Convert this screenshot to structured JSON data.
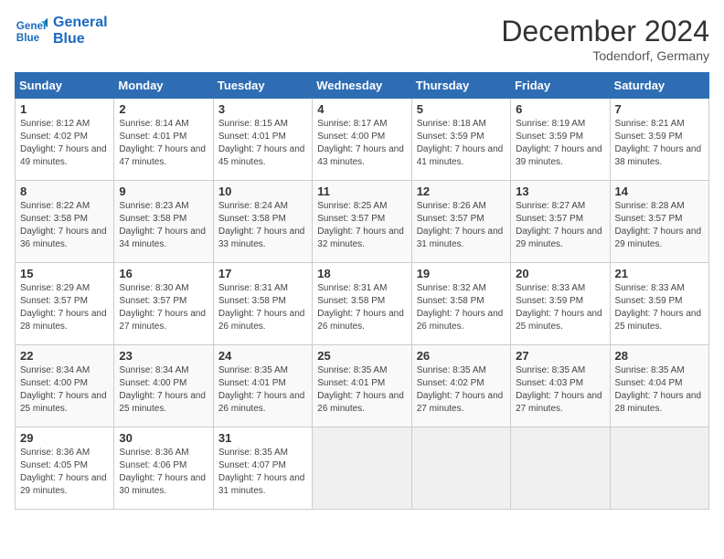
{
  "header": {
    "logo_line1": "General",
    "logo_line2": "Blue",
    "month": "December 2024",
    "location": "Todendorf, Germany"
  },
  "days_of_week": [
    "Sunday",
    "Monday",
    "Tuesday",
    "Wednesday",
    "Thursday",
    "Friday",
    "Saturday"
  ],
  "weeks": [
    [
      {
        "num": "1",
        "sunrise": "Sunrise: 8:12 AM",
        "sunset": "Sunset: 4:02 PM",
        "daylight": "Daylight: 7 hours and 49 minutes."
      },
      {
        "num": "2",
        "sunrise": "Sunrise: 8:14 AM",
        "sunset": "Sunset: 4:01 PM",
        "daylight": "Daylight: 7 hours and 47 minutes."
      },
      {
        "num": "3",
        "sunrise": "Sunrise: 8:15 AM",
        "sunset": "Sunset: 4:01 PM",
        "daylight": "Daylight: 7 hours and 45 minutes."
      },
      {
        "num": "4",
        "sunrise": "Sunrise: 8:17 AM",
        "sunset": "Sunset: 4:00 PM",
        "daylight": "Daylight: 7 hours and 43 minutes."
      },
      {
        "num": "5",
        "sunrise": "Sunrise: 8:18 AM",
        "sunset": "Sunset: 3:59 PM",
        "daylight": "Daylight: 7 hours and 41 minutes."
      },
      {
        "num": "6",
        "sunrise": "Sunrise: 8:19 AM",
        "sunset": "Sunset: 3:59 PM",
        "daylight": "Daylight: 7 hours and 39 minutes."
      },
      {
        "num": "7",
        "sunrise": "Sunrise: 8:21 AM",
        "sunset": "Sunset: 3:59 PM",
        "daylight": "Daylight: 7 hours and 38 minutes."
      }
    ],
    [
      {
        "num": "8",
        "sunrise": "Sunrise: 8:22 AM",
        "sunset": "Sunset: 3:58 PM",
        "daylight": "Daylight: 7 hours and 36 minutes."
      },
      {
        "num": "9",
        "sunrise": "Sunrise: 8:23 AM",
        "sunset": "Sunset: 3:58 PM",
        "daylight": "Daylight: 7 hours and 34 minutes."
      },
      {
        "num": "10",
        "sunrise": "Sunrise: 8:24 AM",
        "sunset": "Sunset: 3:58 PM",
        "daylight": "Daylight: 7 hours and 33 minutes."
      },
      {
        "num": "11",
        "sunrise": "Sunrise: 8:25 AM",
        "sunset": "Sunset: 3:57 PM",
        "daylight": "Daylight: 7 hours and 32 minutes."
      },
      {
        "num": "12",
        "sunrise": "Sunrise: 8:26 AM",
        "sunset": "Sunset: 3:57 PM",
        "daylight": "Daylight: 7 hours and 31 minutes."
      },
      {
        "num": "13",
        "sunrise": "Sunrise: 8:27 AM",
        "sunset": "Sunset: 3:57 PM",
        "daylight": "Daylight: 7 hours and 29 minutes."
      },
      {
        "num": "14",
        "sunrise": "Sunrise: 8:28 AM",
        "sunset": "Sunset: 3:57 PM",
        "daylight": "Daylight: 7 hours and 29 minutes."
      }
    ],
    [
      {
        "num": "15",
        "sunrise": "Sunrise: 8:29 AM",
        "sunset": "Sunset: 3:57 PM",
        "daylight": "Daylight: 7 hours and 28 minutes."
      },
      {
        "num": "16",
        "sunrise": "Sunrise: 8:30 AM",
        "sunset": "Sunset: 3:57 PM",
        "daylight": "Daylight: 7 hours and 27 minutes."
      },
      {
        "num": "17",
        "sunrise": "Sunrise: 8:31 AM",
        "sunset": "Sunset: 3:58 PM",
        "daylight": "Daylight: 7 hours and 26 minutes."
      },
      {
        "num": "18",
        "sunrise": "Sunrise: 8:31 AM",
        "sunset": "Sunset: 3:58 PM",
        "daylight": "Daylight: 7 hours and 26 minutes."
      },
      {
        "num": "19",
        "sunrise": "Sunrise: 8:32 AM",
        "sunset": "Sunset: 3:58 PM",
        "daylight": "Daylight: 7 hours and 26 minutes."
      },
      {
        "num": "20",
        "sunrise": "Sunrise: 8:33 AM",
        "sunset": "Sunset: 3:59 PM",
        "daylight": "Daylight: 7 hours and 25 minutes."
      },
      {
        "num": "21",
        "sunrise": "Sunrise: 8:33 AM",
        "sunset": "Sunset: 3:59 PM",
        "daylight": "Daylight: 7 hours and 25 minutes."
      }
    ],
    [
      {
        "num": "22",
        "sunrise": "Sunrise: 8:34 AM",
        "sunset": "Sunset: 4:00 PM",
        "daylight": "Daylight: 7 hours and 25 minutes."
      },
      {
        "num": "23",
        "sunrise": "Sunrise: 8:34 AM",
        "sunset": "Sunset: 4:00 PM",
        "daylight": "Daylight: 7 hours and 25 minutes."
      },
      {
        "num": "24",
        "sunrise": "Sunrise: 8:35 AM",
        "sunset": "Sunset: 4:01 PM",
        "daylight": "Daylight: 7 hours and 26 minutes."
      },
      {
        "num": "25",
        "sunrise": "Sunrise: 8:35 AM",
        "sunset": "Sunset: 4:01 PM",
        "daylight": "Daylight: 7 hours and 26 minutes."
      },
      {
        "num": "26",
        "sunrise": "Sunrise: 8:35 AM",
        "sunset": "Sunset: 4:02 PM",
        "daylight": "Daylight: 7 hours and 27 minutes."
      },
      {
        "num": "27",
        "sunrise": "Sunrise: 8:35 AM",
        "sunset": "Sunset: 4:03 PM",
        "daylight": "Daylight: 7 hours and 27 minutes."
      },
      {
        "num": "28",
        "sunrise": "Sunrise: 8:35 AM",
        "sunset": "Sunset: 4:04 PM",
        "daylight": "Daylight: 7 hours and 28 minutes."
      }
    ],
    [
      {
        "num": "29",
        "sunrise": "Sunrise: 8:36 AM",
        "sunset": "Sunset: 4:05 PM",
        "daylight": "Daylight: 7 hours and 29 minutes."
      },
      {
        "num": "30",
        "sunrise": "Sunrise: 8:36 AM",
        "sunset": "Sunset: 4:06 PM",
        "daylight": "Daylight: 7 hours and 30 minutes."
      },
      {
        "num": "31",
        "sunrise": "Sunrise: 8:35 AM",
        "sunset": "Sunset: 4:07 PM",
        "daylight": "Daylight: 7 hours and 31 minutes."
      },
      null,
      null,
      null,
      null
    ]
  ]
}
